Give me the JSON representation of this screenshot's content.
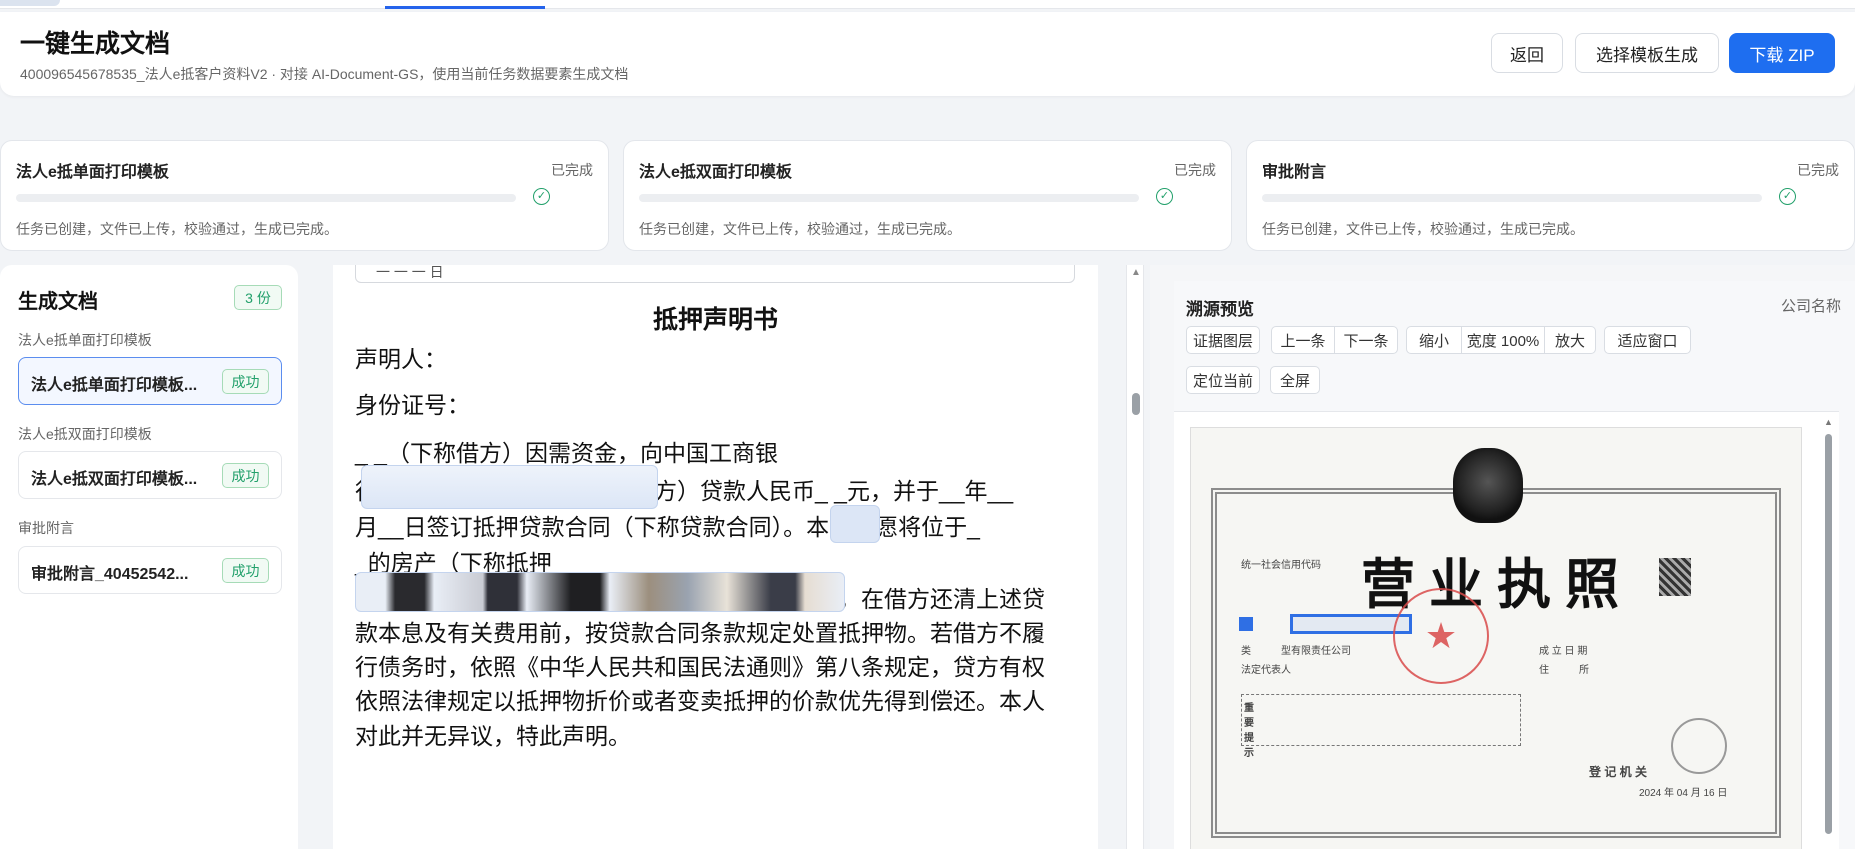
{
  "header": {
    "title": "一键生成文档",
    "subtitle": "400096545678535_法人e抵客户资料V2 · 对接 AI-Document-GS，使用当前任务数据要素生成文档",
    "back_label": "返回",
    "choose_template_label": "选择模板生成",
    "download_label": "下载 ZIP"
  },
  "cards": [
    {
      "title": "法人e抵单面打印模板",
      "status": "已完成",
      "desc": "任务已创建，文件已上传，校验通过，生成已完成。"
    },
    {
      "title": "法人e抵双面打印模板",
      "status": "已完成",
      "desc": "任务已创建，文件已上传，校验通过，生成已完成。"
    },
    {
      "title": "审批附言",
      "status": "已完成",
      "desc": "任务已创建，文件已上传，校验通过，生成已完成。"
    }
  ],
  "sidebar": {
    "title": "生成文档",
    "count": "3 份",
    "groups": [
      {
        "label": "法人e抵单面打印模板",
        "item": "法人e抵单面打印模板...",
        "tag": "成功"
      },
      {
        "label": "法人e抵双面打印模板",
        "item": "法人e抵双面打印模板...",
        "tag": "成功"
      },
      {
        "label": "审批附言",
        "item": "审批附言_40452542...",
        "tag": "成功"
      }
    ]
  },
  "document": {
    "prev_fragment": "一 一 一 日",
    "title": "抵押声明书",
    "lines": [
      "声明人：",
      "身份证号：",
      "_                                            _（下称借方）因需资金，向中国工商银",
      "行深圳市分行营业部（下称贷方）贷款人民币_         _元，并于__年__",
      "月__日签订抵押贷款合同（下称贷款合同）。本人自愿将位于_",
      "                                                                                _的房产（下称抵押",
      "物）抵押给贷方，作为借方偿还上述贷款的保证，在借方还清上述贷",
      "款本息及有关费用前，按贷款合同条款规定处置抵押物。若借方不履",
      "行债务时，依照《中华人民共和国民法通则》第八条规定，贷方有权",
      "依照法律规定以抵押物折价或者变卖抵押的价款优先得到偿还。本人",
      "对此并无异议，特此声明。"
    ]
  },
  "trace": {
    "title": "溯源预览",
    "company_label": "公司名称",
    "toolbar": {
      "evidence_layer": "证据图层",
      "prev": "上一条",
      "next": "下一条",
      "zoom_out": "缩小",
      "width": "宽度 100%",
      "zoom_in": "放大",
      "fit": "适应窗口",
      "locate": "定位当前",
      "fullscreen": "全屏"
    },
    "license": {
      "title": "营业执照",
      "credit_code_label": "统一社会信用代码",
      "type_label": "类　　　型",
      "type_value": "有限责任公司",
      "legal_rep_label": "法定代表人",
      "established_label": "成 立 日 期",
      "address_label": "住　　　所",
      "notice_label": "重要提示",
      "authority_label": "登 记 机 关",
      "date": "2024 年 04 月 16 日"
    }
  },
  "colors": {
    "accent": "#1e6ef0",
    "success": "#22a06b",
    "highlight": "#2f6fe4",
    "stamp_red": "#d94b4b"
  }
}
